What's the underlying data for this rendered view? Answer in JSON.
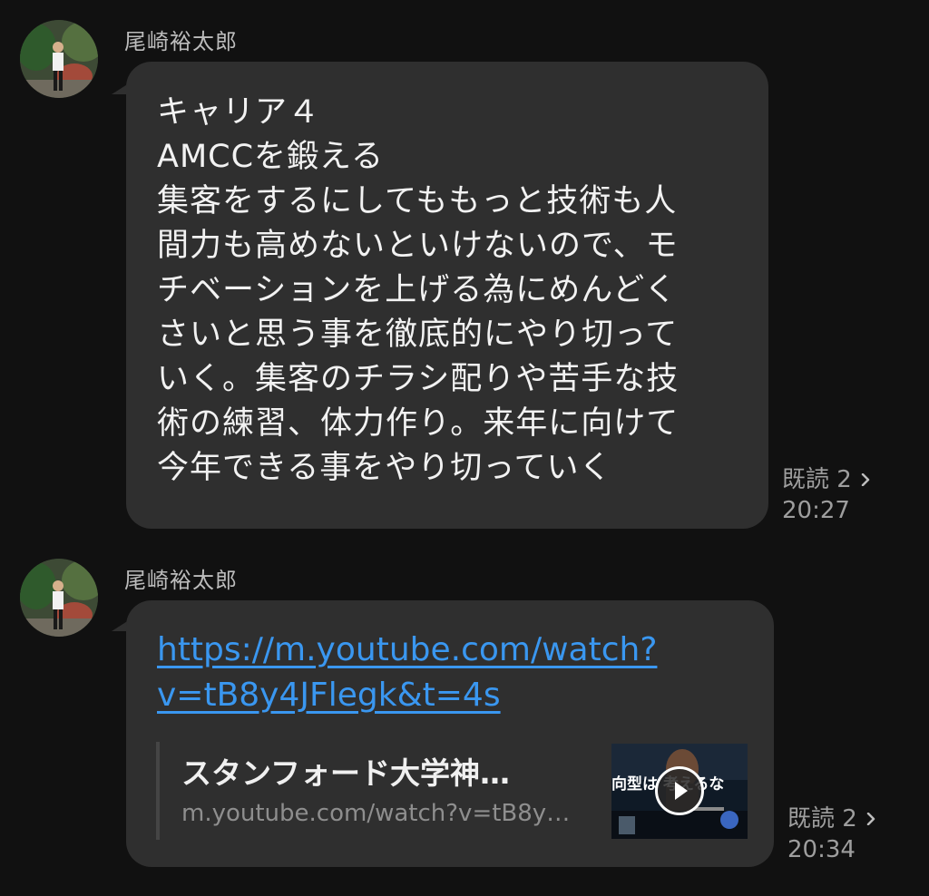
{
  "messages": [
    {
      "sender": "尾崎裕太郎",
      "lines": [
        "キャリア４",
        "AMCCを鍛える",
        "集客をするにしてももっと技術も人",
        "間力も高めないといけないので、モ",
        "チベーションを上げる為にめんどく",
        "さいと思う事を徹底的にやり切って",
        "いく。集客のチラシ配りや苦手な技",
        "術の練習、体力作り。来年に向けて",
        "今年できる事をやり切っていく"
      ],
      "read_label": "既読 2",
      "time": "20:27"
    },
    {
      "sender": "尾崎裕太郎",
      "link_lines": [
        "https://m.youtube.com/watch?",
        "v=tB8y4JFlegk&t=4s"
      ],
      "preview": {
        "title": "スタンフォード大学神…",
        "url": "m.youtube.com/watch?v=tB8y…",
        "thumbnail_text": "向型は    考えるな"
      },
      "read_label": "既読 2",
      "time": "20:34"
    }
  ],
  "colors": {
    "background": "#111111",
    "bubble": "#2f2f2f",
    "link": "#3a97f0",
    "meta": "#9e9e9e"
  }
}
